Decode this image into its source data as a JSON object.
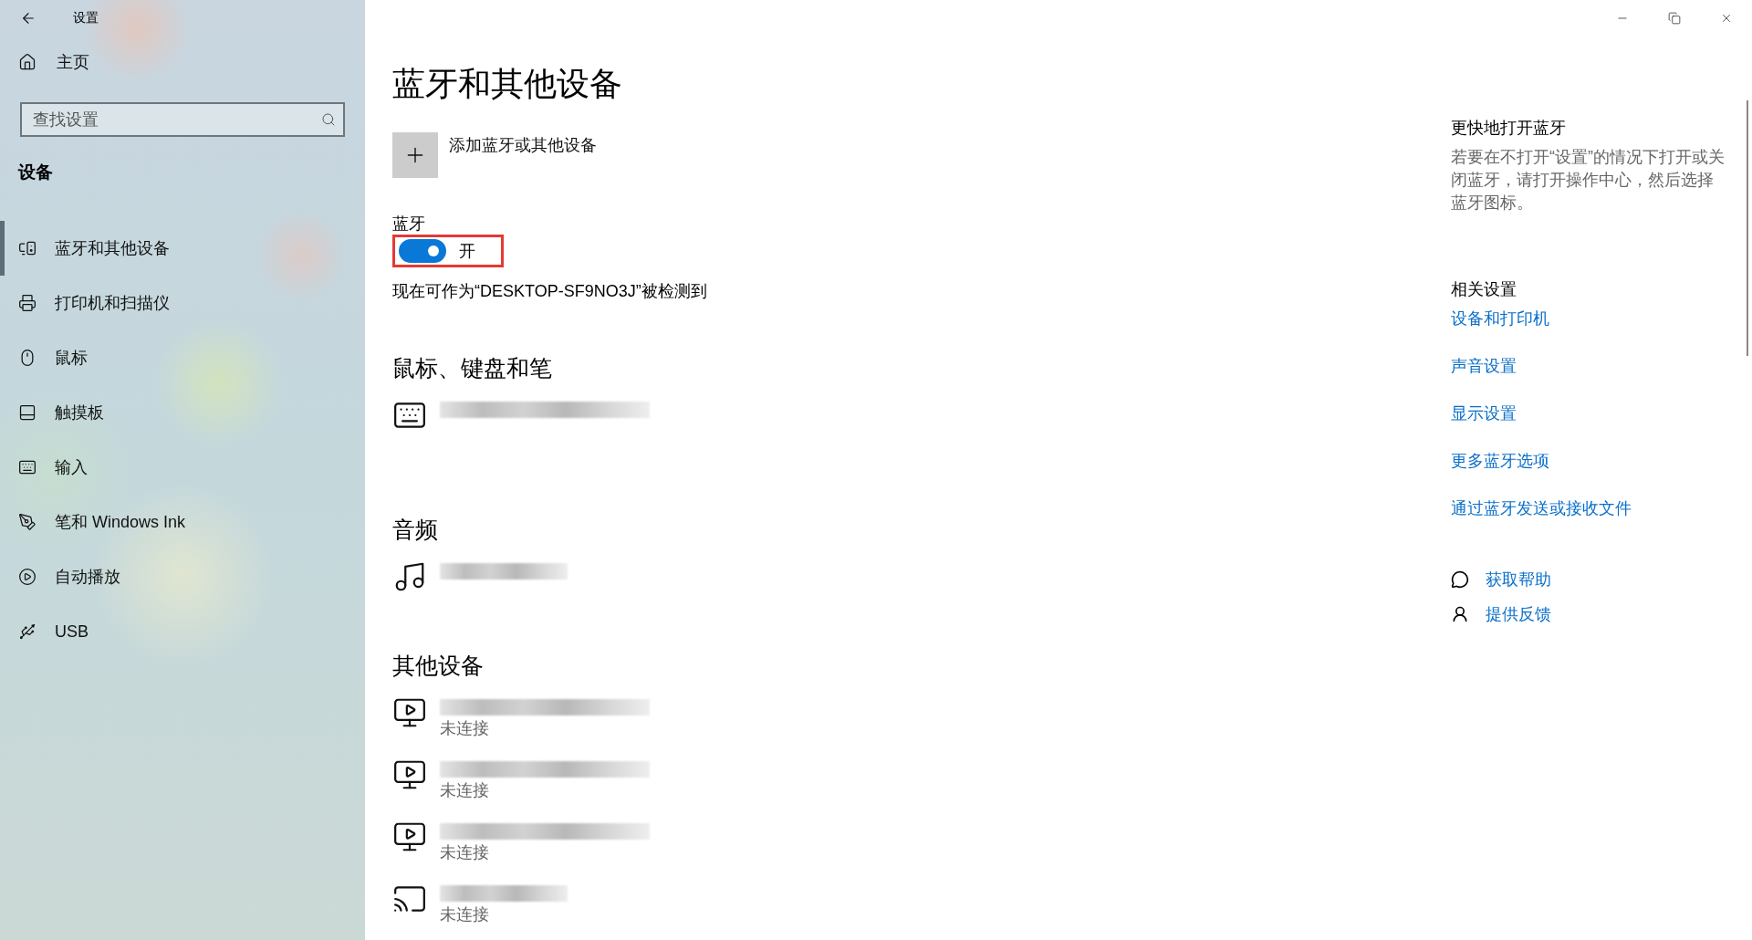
{
  "window": {
    "title": "设置"
  },
  "sidebar": {
    "home": "主页",
    "search": {
      "placeholder": "查找设置"
    },
    "section": "设备",
    "items": [
      {
        "label": "蓝牙和其他设备",
        "kind": "bluetooth",
        "selected": true
      },
      {
        "label": "打印机和扫描仪",
        "kind": "printer",
        "selected": false
      },
      {
        "label": "鼠标",
        "kind": "mouse",
        "selected": false
      },
      {
        "label": "触摸板",
        "kind": "touchpad",
        "selected": false
      },
      {
        "label": "输入",
        "kind": "keyboard",
        "selected": false
      },
      {
        "label": "笔和 Windows Ink",
        "kind": "pen",
        "selected": false
      },
      {
        "label": "自动播放",
        "kind": "autoplay",
        "selected": false
      },
      {
        "label": "USB",
        "kind": "usb",
        "selected": false
      }
    ]
  },
  "main": {
    "title": "蓝牙和其他设备",
    "add_button": "添加蓝牙或其他设备",
    "bluetooth": {
      "label": "蓝牙",
      "on": true,
      "state_text": "开",
      "highlighted": true
    },
    "discoverable": "现在可作为“DESKTOP-SF9NO3J”被检测到",
    "sections": [
      {
        "title": "鼠标、键盘和笔",
        "devices": [
          {
            "kind": "keyboard"
          }
        ]
      },
      {
        "title": "音频",
        "devices": [
          {
            "kind": "audio"
          }
        ]
      },
      {
        "title": "其他设备",
        "devices": [
          {
            "kind": "media",
            "status": "未连接"
          },
          {
            "kind": "media",
            "status": "未连接"
          },
          {
            "kind": "media",
            "status": "未连接"
          },
          {
            "kind": "display",
            "status": "未连接"
          }
        ]
      }
    ]
  },
  "aside": {
    "tip_title": "更快地打开蓝牙",
    "tip_text": "若要在不打开“设置”的情况下打开或关闭蓝牙，请打开操作中心，然后选择蓝牙图标。",
    "related_title": "相关设置",
    "related_links": [
      "设备和打印机",
      "声音设置",
      "显示设置",
      "更多蓝牙选项",
      "通过蓝牙发送或接收文件"
    ],
    "help": [
      {
        "kind": "help",
        "label": "获取帮助"
      },
      {
        "kind": "feedback",
        "label": "提供反馈"
      }
    ]
  }
}
